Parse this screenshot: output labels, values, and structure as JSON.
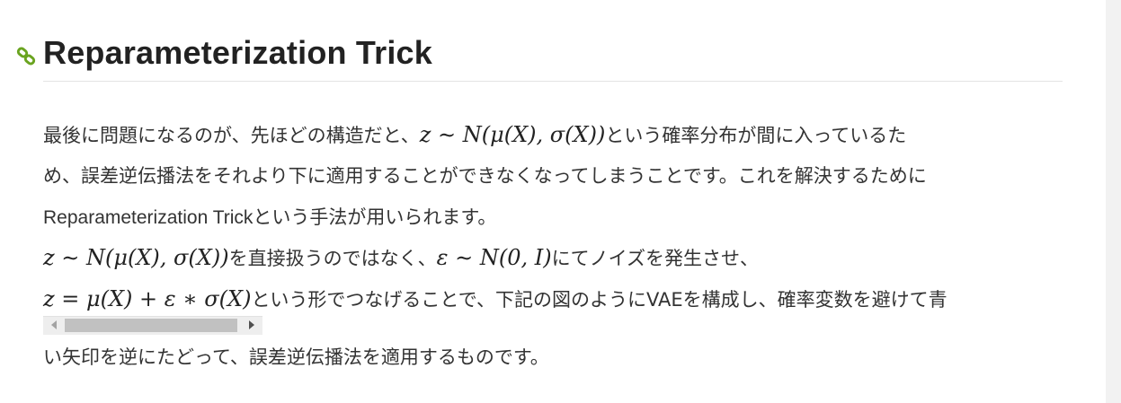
{
  "heading": {
    "title": "Reparameterization Trick",
    "anchor_icon": "link-icon",
    "anchor_color": "#6aa420"
  },
  "paragraph": {
    "line1": {
      "pre": "最後に問題になるのが、先ほどの構造だと、",
      "math": "z ∼ N(μ(X), σ(X))",
      "post": "という確率分布が間に入っているた"
    },
    "line2": "め、誤差逆伝播法をそれより下に適用することができなくなってしまうことです。これを解決するために",
    "line3": {
      "pre": "Reparameterization Trick",
      "post": "という手法が用いられます。"
    },
    "line4": {
      "math1": "z ∼ N(μ(X), σ(X))",
      "mid": "を直接扱うのではなく、",
      "math2": "ε ∼ N(0, I)",
      "post": "にてノイズを発生させ、"
    },
    "line5": {
      "math": "z = μ(X) + ε ∗ σ(X)",
      "post": "という形でつなげることで、下記の図のようにVAEを構成し、確率変数を避けて青"
    },
    "line6": "い矢印を逆にたどって、誤差逆伝播法を適用するものです。"
  },
  "scrollbar": {
    "left_arrow_icon": "scroll-left-arrow-icon",
    "right_arrow_icon": "scroll-right-arrow-icon"
  },
  "colors": {
    "text": "#333333",
    "heading": "#222222",
    "rule": "#e3e3e3",
    "gutter": "#f2f2f2"
  }
}
